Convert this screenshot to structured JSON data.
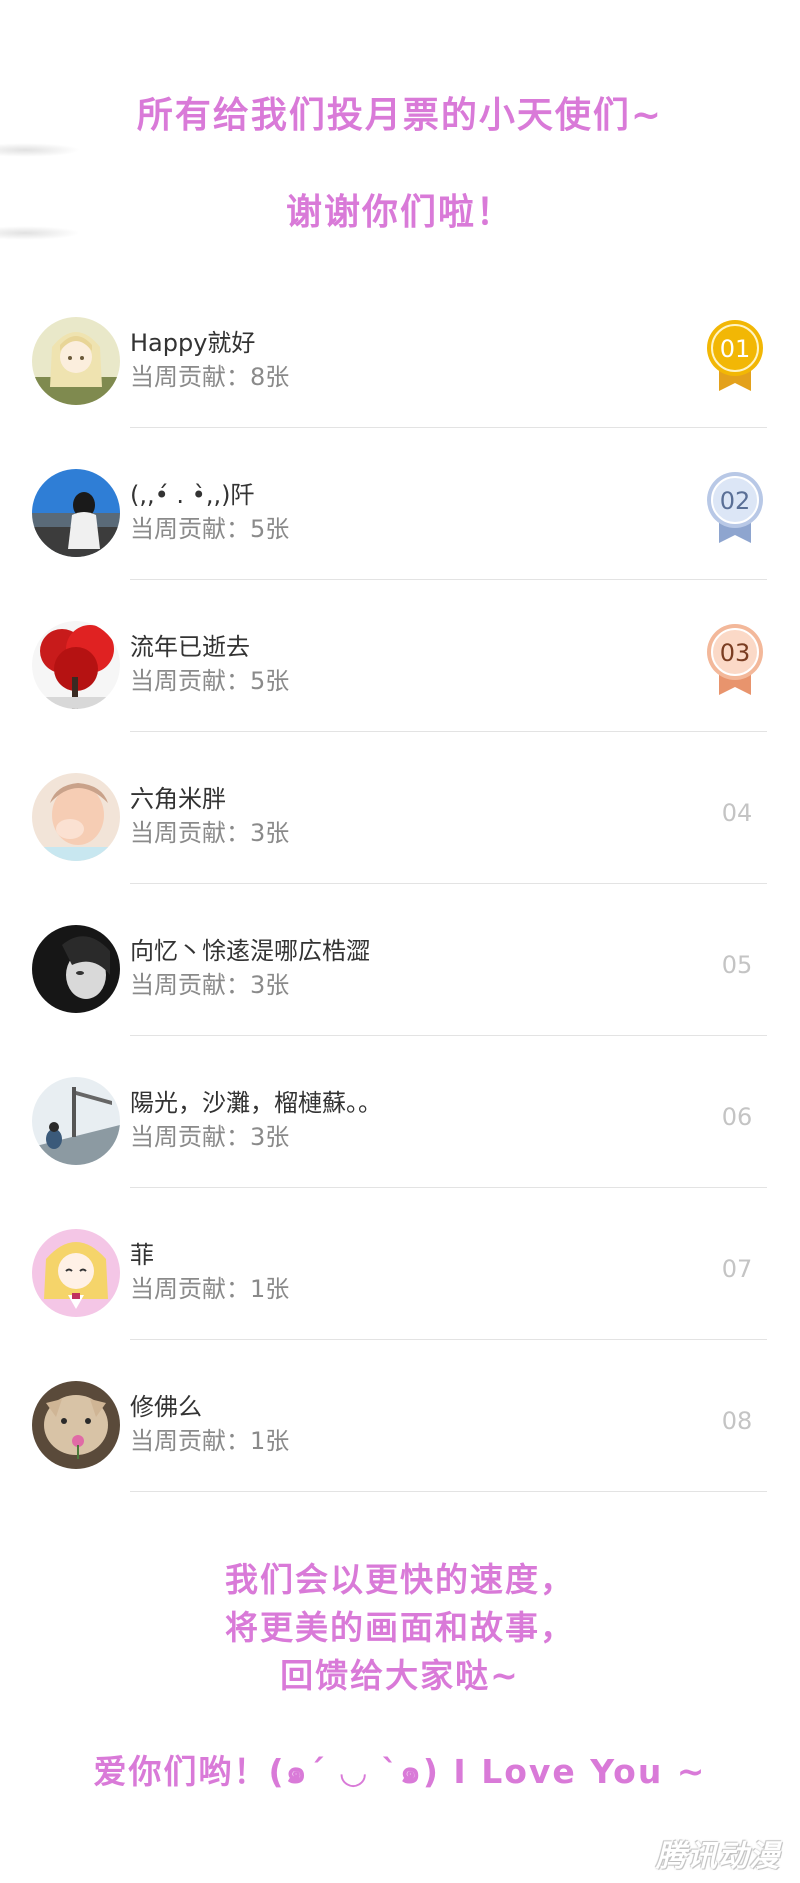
{
  "header": {
    "line1": "所有给我们投月票的小天使们~",
    "line2": "谢谢你们啦！"
  },
  "list": [
    {
      "name": "Happy就好",
      "contribution": "当周贡献：8张",
      "rank": "01",
      "medal": "gold",
      "avatar_icon": "anime-girl-avatar"
    },
    {
      "name": "(,,•́ . •̀,,)阡",
      "contribution": "当周贡献：5张",
      "rank": "02",
      "medal": "silver",
      "avatar_icon": "girl-by-sea-avatar"
    },
    {
      "name": "流年已逝去",
      "contribution": "当周贡献：5张",
      "rank": "03",
      "medal": "bronze",
      "avatar_icon": "red-tree-avatar"
    },
    {
      "name": "六角米胖",
      "contribution": "当周贡献：3张",
      "rank": "04",
      "medal": "none",
      "avatar_icon": "child-face-avatar"
    },
    {
      "name": "向忆丶悇逺湜哪広梏澀",
      "contribution": "当周贡献：3张",
      "rank": "05",
      "medal": "none",
      "avatar_icon": "dark-portrait-avatar"
    },
    {
      "name": "陽光，沙灘，榴槤蘇。。",
      "contribution": "当周贡献：3张",
      "rank": "06",
      "medal": "none",
      "avatar_icon": "railway-avatar"
    },
    {
      "name": "菲",
      "contribution": "当周贡献：1张",
      "rank": "07",
      "medal": "none",
      "avatar_icon": "cartoon-blonde-avatar"
    },
    {
      "name": "修佛么",
      "contribution": "当周贡献：1张",
      "rank": "08",
      "medal": "none",
      "avatar_icon": "cat-with-flower-avatar"
    }
  ],
  "footer": {
    "line1": "我们会以更快的速度，",
    "line2": "将更美的画面和故事，",
    "line3": "回馈给大家哒~",
    "love": "爱你们哟！(๑´ ◡ `๑) I Love You ~"
  },
  "watermark": "腾讯动漫",
  "colors": {
    "accent": "#d97ad8",
    "gold": "#f2b705",
    "silver": "#b8c8e6",
    "bronze": "#f3b89a"
  }
}
